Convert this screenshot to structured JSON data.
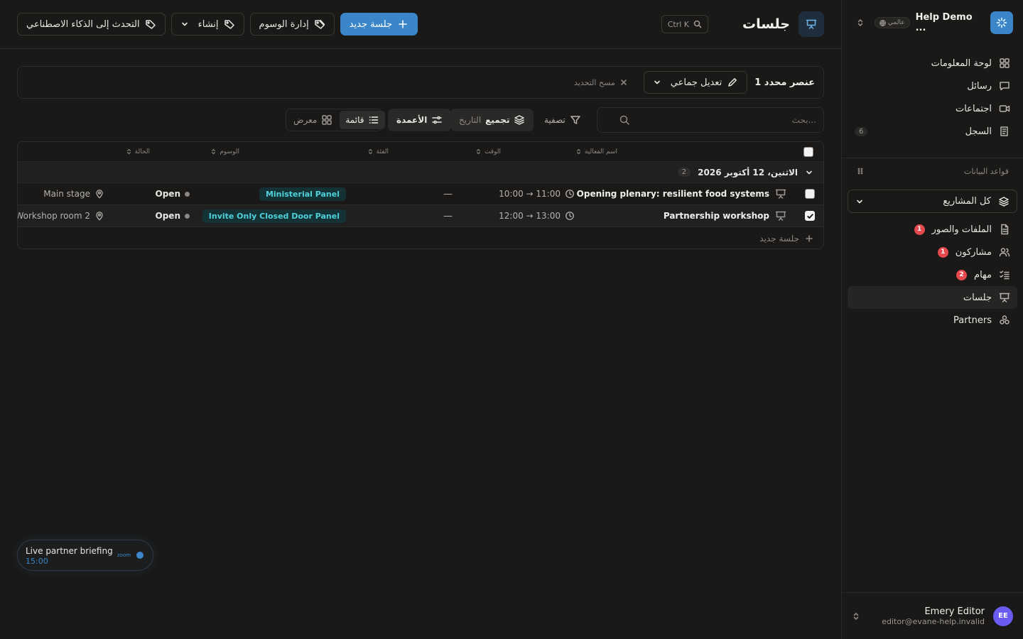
{
  "sidebar": {
    "workspace_name": "Help Demo ...",
    "workspace_scope": "عالمي",
    "nav": [
      {
        "label": "لوحة المعلومات",
        "icon": "dashboard-icon"
      },
      {
        "label": "رسائل",
        "icon": "message-icon"
      },
      {
        "label": "اجتماعات",
        "icon": "video-icon"
      },
      {
        "label": "السجل",
        "icon": "log-icon",
        "count": "6"
      }
    ],
    "databases_title": "قواعد البيانات",
    "project_select": "كل المشاريع",
    "db_items": [
      {
        "label": "الملفات والصور",
        "icon": "file-icon",
        "badge": "1"
      },
      {
        "label": "مشاركون",
        "icon": "users-icon",
        "badge": "1"
      },
      {
        "label": "مهام",
        "icon": "tasks-icon",
        "badge": "2"
      },
      {
        "label": "جلسات",
        "icon": "presentation-icon",
        "active": true
      },
      {
        "label": "Partners",
        "icon": "partners-icon"
      }
    ],
    "user": {
      "initials": "EE",
      "name": "Emery Editor",
      "email": "editor@evane-help.invalid"
    }
  },
  "header": {
    "title": "جلسات",
    "search_shortcut": "Ctrl K",
    "new_session": "جلسة جديد",
    "manage_tags": "إدارة الوسوم",
    "create": "إنشاء",
    "ask_ai": "التحدث إلى الذكاء الاصطناعي"
  },
  "selection": {
    "count_label": "1 عنصر محدد",
    "bulk_edit": "تعديل جماعي",
    "clear": "مسح التحديد"
  },
  "toolbar": {
    "search_placeholder": "بحث...",
    "filter": "تصفية",
    "group_prefix": "تجميع",
    "group_value": "التاريخ",
    "columns": "الأعمدة",
    "list_view": "قائمة",
    "gallery_view": "معرض"
  },
  "table": {
    "columns": {
      "name": "اسم الفعالية",
      "time": "الوقت",
      "category": "الفئة",
      "tags": "الوسوم",
      "status": "الحالة"
    },
    "group": {
      "label": "الاثنين، 12 أكتوبر 2026",
      "count": "2"
    },
    "rows": [
      {
        "name": "Opening plenary: resilient food systems",
        "time": "10:00 → 11:00",
        "category": "—",
        "tag": "Ministerial Panel",
        "status": "Open",
        "location": "Main stage",
        "selected": false
      },
      {
        "name": "Partnership workshop",
        "time": "12:00 → 13:00",
        "category": "—",
        "tag": "Invite Only Closed Door Panel",
        "status": "Open",
        "location": "Workshop room 2",
        "selected": true
      }
    ],
    "add_row": "جلسة جديد"
  },
  "live_card": {
    "title": "Live partner briefing",
    "time": "15:00",
    "provider": "zoom"
  },
  "colors": {
    "accent": "#3a86c8",
    "tag_text": "#4fd1d9",
    "badge_red": "#e5484d",
    "background": "#1a1918"
  }
}
